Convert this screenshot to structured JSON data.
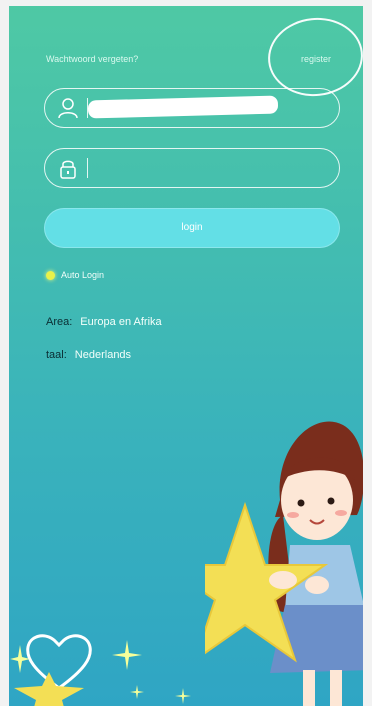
{
  "login_form": {
    "forgot_password": "Wachtwoord vergeten?",
    "register": "register",
    "username_value": "",
    "password_value": "",
    "login_button": "login",
    "auto_login_label": "Auto Login"
  },
  "settings": {
    "area_label": "Area:",
    "area_value": "Europa en Afrika",
    "language_label": "taal:",
    "language_value": "Nederlands"
  },
  "icons": {
    "user": "user-icon",
    "lock": "lock-icon",
    "heart": "heart-icon"
  },
  "colors": {
    "background_top": "#4fc9a4",
    "background_bottom": "#2fa5c4",
    "login_button": "#63dfe6",
    "auto_login_dot": "#e8f24a"
  }
}
